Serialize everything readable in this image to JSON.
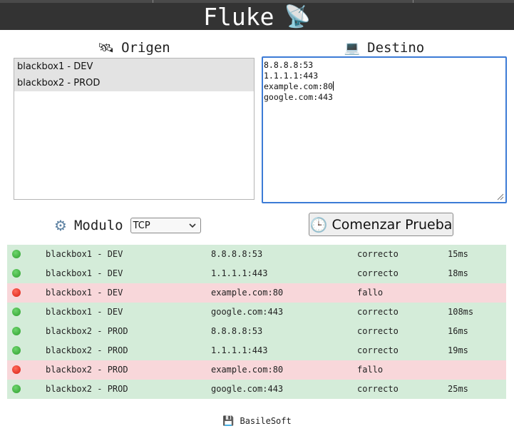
{
  "header": {
    "title": "Fluke",
    "icon": "satellite-dish-icon"
  },
  "origin": {
    "title": "Origen",
    "icon": "satellite-icon",
    "items": [
      {
        "label": "blackbox1 - DEV",
        "selected": true
      },
      {
        "label": "blackbox2 - PROD",
        "selected": true
      }
    ]
  },
  "destination": {
    "title": "Destino",
    "icon": "laptop-icon",
    "lines": [
      "8.8.8.8:53",
      "1.1.1.1:443",
      "example.com:80",
      "google.com:443"
    ]
  },
  "module": {
    "label": "Modulo",
    "icon": "gear-icon",
    "selected": "TCP"
  },
  "start_button": {
    "label": "Comenzar Prueba",
    "icon": "clock-icon"
  },
  "results": [
    {
      "status": "ok",
      "source": "blackbox1 - DEV",
      "target": "8.8.8.8:53",
      "result": "correcto",
      "time": "15ms"
    },
    {
      "status": "ok",
      "source": "blackbox1 - DEV",
      "target": "1.1.1.1:443",
      "result": "correcto",
      "time": "18ms"
    },
    {
      "status": "fail",
      "source": "blackbox1 - DEV",
      "target": "example.com:80",
      "result": "fallo",
      "time": ""
    },
    {
      "status": "ok",
      "source": "blackbox1 - DEV",
      "target": "google.com:443",
      "result": "correcto",
      "time": "108ms"
    },
    {
      "status": "ok",
      "source": "blackbox2 - PROD",
      "target": "8.8.8.8:53",
      "result": "correcto",
      "time": "16ms"
    },
    {
      "status": "ok",
      "source": "blackbox2 - PROD",
      "target": "1.1.1.1:443",
      "result": "correcto",
      "time": "19ms"
    },
    {
      "status": "fail",
      "source": "blackbox2 - PROD",
      "target": "example.com:80",
      "result": "fallo",
      "time": ""
    },
    {
      "status": "ok",
      "source": "blackbox2 - PROD",
      "target": "google.com:443",
      "result": "correcto",
      "time": "25ms"
    }
  ],
  "footer": {
    "label": "BasileSoft",
    "icon": "floppy-disk-icon"
  },
  "colors": {
    "header_bg": "#333333",
    "success_row": "#d4ecd9",
    "fail_row": "#f8d7da",
    "focus_border": "#3c7bd6"
  }
}
